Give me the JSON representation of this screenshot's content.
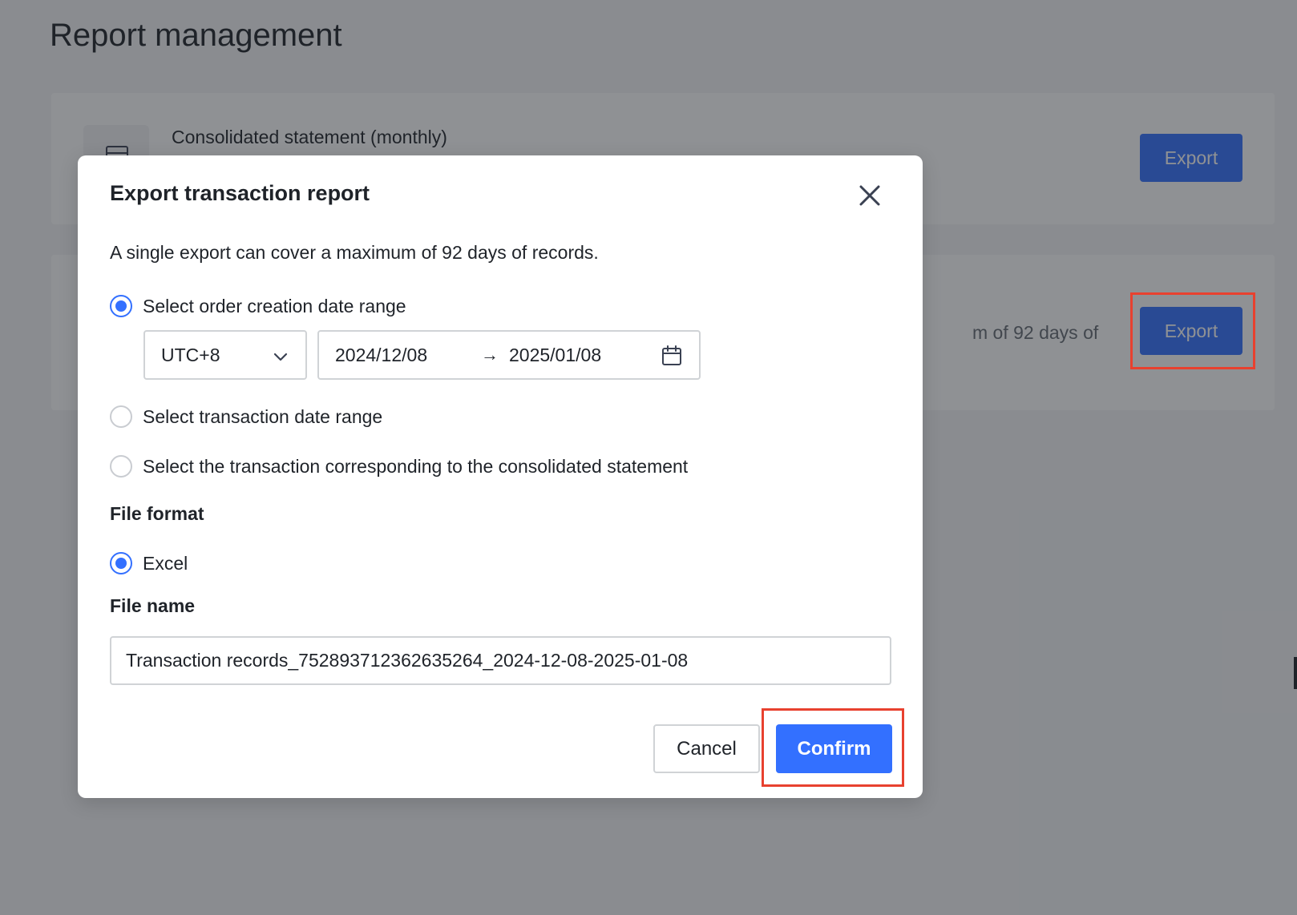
{
  "page": {
    "title": "Report management"
  },
  "cards": [
    {
      "title": "Consolidated statement (monthly)",
      "export_label": "Export"
    },
    {
      "description_visible": "m of 92 days of",
      "export_label": "Export"
    }
  ],
  "modal": {
    "title": "Export transaction report",
    "notice": "A single export can cover a maximum of 92 days of records.",
    "range_options": [
      {
        "label": "Select order creation date range",
        "checked": true
      },
      {
        "label": "Select transaction date range",
        "checked": false
      },
      {
        "label": "Select the transaction corresponding to the consolidated statement",
        "checked": false
      }
    ],
    "timezone": "UTC+8",
    "date_start": "2024/12/08",
    "date_arrow": "→",
    "date_end": "2025/01/08",
    "file_format_label": "File format",
    "format_options": [
      {
        "label": "Excel",
        "checked": true
      }
    ],
    "file_name_label": "File name",
    "file_name_value": "Transaction records_752893712362635264_2024-12-08-2025-01-08",
    "cancel_label": "Cancel",
    "confirm_label": "Confirm"
  },
  "colors": {
    "primary": "#3370ff",
    "highlight": "#e8412f",
    "overlay": "rgba(31,35,41,0.5)"
  },
  "icons": {
    "close": "close-icon",
    "dropdown": "chevron-down-icon",
    "calendar": "calendar-icon",
    "report": "document-icon"
  }
}
